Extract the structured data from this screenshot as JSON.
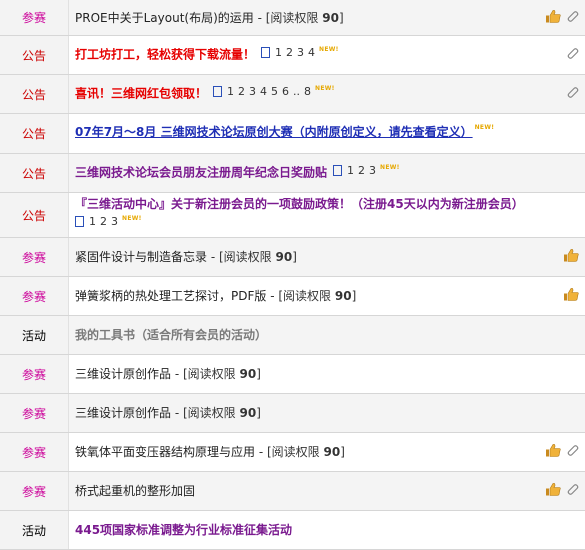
{
  "rows": [
    {
      "category": "参赛",
      "cat_color": "canssai",
      "title": "PROE中关于Layout(布局)的运用",
      "title_style": "black",
      "perm_prefix": " - [阅读权限 ",
      "perm_value": "90",
      "perm_suffix": "]",
      "pages": [],
      "new": "",
      "thumb": true,
      "clip": true
    },
    {
      "category": "公告",
      "cat_color": "gonggao",
      "title": "打工坊打工，轻松获得下载流量！",
      "title_style": "red",
      "perm_prefix": "",
      "perm_value": "",
      "perm_suffix": "",
      "pages": [
        "1",
        "2",
        "3",
        "4"
      ],
      "new": "NEW!",
      "thumb": false,
      "clip": true
    },
    {
      "category": "公告",
      "cat_color": "gonggao",
      "title": "喜讯！三维网红包领取！",
      "title_style": "red",
      "perm_prefix": "",
      "perm_value": "",
      "perm_suffix": "",
      "pages": [
        "1",
        "2",
        "3",
        "4",
        "5",
        "6",
        "..",
        "8"
      ],
      "new": "NEW!",
      "thumb": false,
      "clip": true
    },
    {
      "category": "公告",
      "cat_color": "gonggao",
      "title": "07年7月～8月 三维网技术论坛原创大赛（内附原创定义，请先查看定义）",
      "title_style": "blue",
      "perm_prefix": "",
      "perm_value": "",
      "perm_suffix": "",
      "pages": [],
      "new": "NEW!",
      "thumb": false,
      "clip": false
    },
    {
      "category": "公告",
      "cat_color": "gonggao",
      "title": "三维网技术论坛会员朋友注册周年纪念日奖励贴",
      "title_style": "purple",
      "perm_prefix": "",
      "perm_value": "",
      "perm_suffix": "",
      "pages": [
        "1",
        "2",
        "3"
      ],
      "new": "NEW!",
      "thumb": false,
      "clip": false
    },
    {
      "category": "公告",
      "cat_color": "gonggao",
      "title": "『三维活动中心』关于新注册会员的一项鼓励政策！（注册45天以内为新注册会员）",
      "title_style": "purple",
      "perm_prefix": "",
      "perm_value": "",
      "perm_suffix": "",
      "pages": [
        "1",
        "2",
        "3"
      ],
      "new": "NEW!",
      "thumb": false,
      "clip": false,
      "wrap": true
    },
    {
      "category": "参赛",
      "cat_color": "canssai",
      "title": "紧固件设计与制造备忘录",
      "title_style": "black",
      "perm_prefix": " - [阅读权限 ",
      "perm_value": "90",
      "perm_suffix": "]",
      "pages": [],
      "new": "",
      "thumb": true,
      "clip": false
    },
    {
      "category": "参赛",
      "cat_color": "canssai",
      "title": "弹簧浆柄的热处理工艺探讨，PDF版",
      "title_style": "black",
      "perm_prefix": " - [阅读权限 ",
      "perm_value": "90",
      "perm_suffix": "]",
      "pages": [],
      "new": "",
      "thumb": true,
      "clip": false
    },
    {
      "category": "活动",
      "cat_color": "huodong",
      "title": "我的工具书（适合所有会员的活动）",
      "title_style": "gray",
      "perm_prefix": "",
      "perm_value": "",
      "perm_suffix": "",
      "pages": [],
      "new": "",
      "thumb": false,
      "clip": false
    },
    {
      "category": "参赛",
      "cat_color": "canssai",
      "title": "三维设计原创作品",
      "title_style": "black",
      "perm_prefix": " - [阅读权限 ",
      "perm_value": "90",
      "perm_suffix": "]",
      "pages": [],
      "new": "",
      "thumb": false,
      "clip": false
    },
    {
      "category": "参赛",
      "cat_color": "canssai",
      "title": "三维设计原创作品",
      "title_style": "black",
      "perm_prefix": " - [阅读权限 ",
      "perm_value": "90",
      "perm_suffix": "]",
      "pages": [],
      "new": "",
      "thumb": false,
      "clip": false
    },
    {
      "category": "参赛",
      "cat_color": "canssai",
      "title": "铁氧体平面变压器结构原理与应用",
      "title_style": "black",
      "perm_prefix": " - [阅读权限 ",
      "perm_value": "90",
      "perm_suffix": "]",
      "pages": [],
      "new": "",
      "thumb": true,
      "clip": true
    },
    {
      "category": "参赛",
      "cat_color": "canssai",
      "title": "桥式起重机的整形加固",
      "title_style": "black",
      "perm_prefix": "",
      "perm_value": "",
      "perm_suffix": "",
      "pages": [],
      "new": "",
      "thumb": true,
      "clip": true
    },
    {
      "category": "活动",
      "cat_color": "huodong",
      "title": "445项国家标准调整为行业标准征集活动",
      "title_style": "purple",
      "perm_prefix": "",
      "perm_value": "",
      "perm_suffix": "",
      "pages": [],
      "new": "",
      "thumb": false,
      "clip": false
    }
  ],
  "colors": {
    "canssai": "#cc0099",
    "gonggao": "#cc0000",
    "huodong": "#000000"
  }
}
